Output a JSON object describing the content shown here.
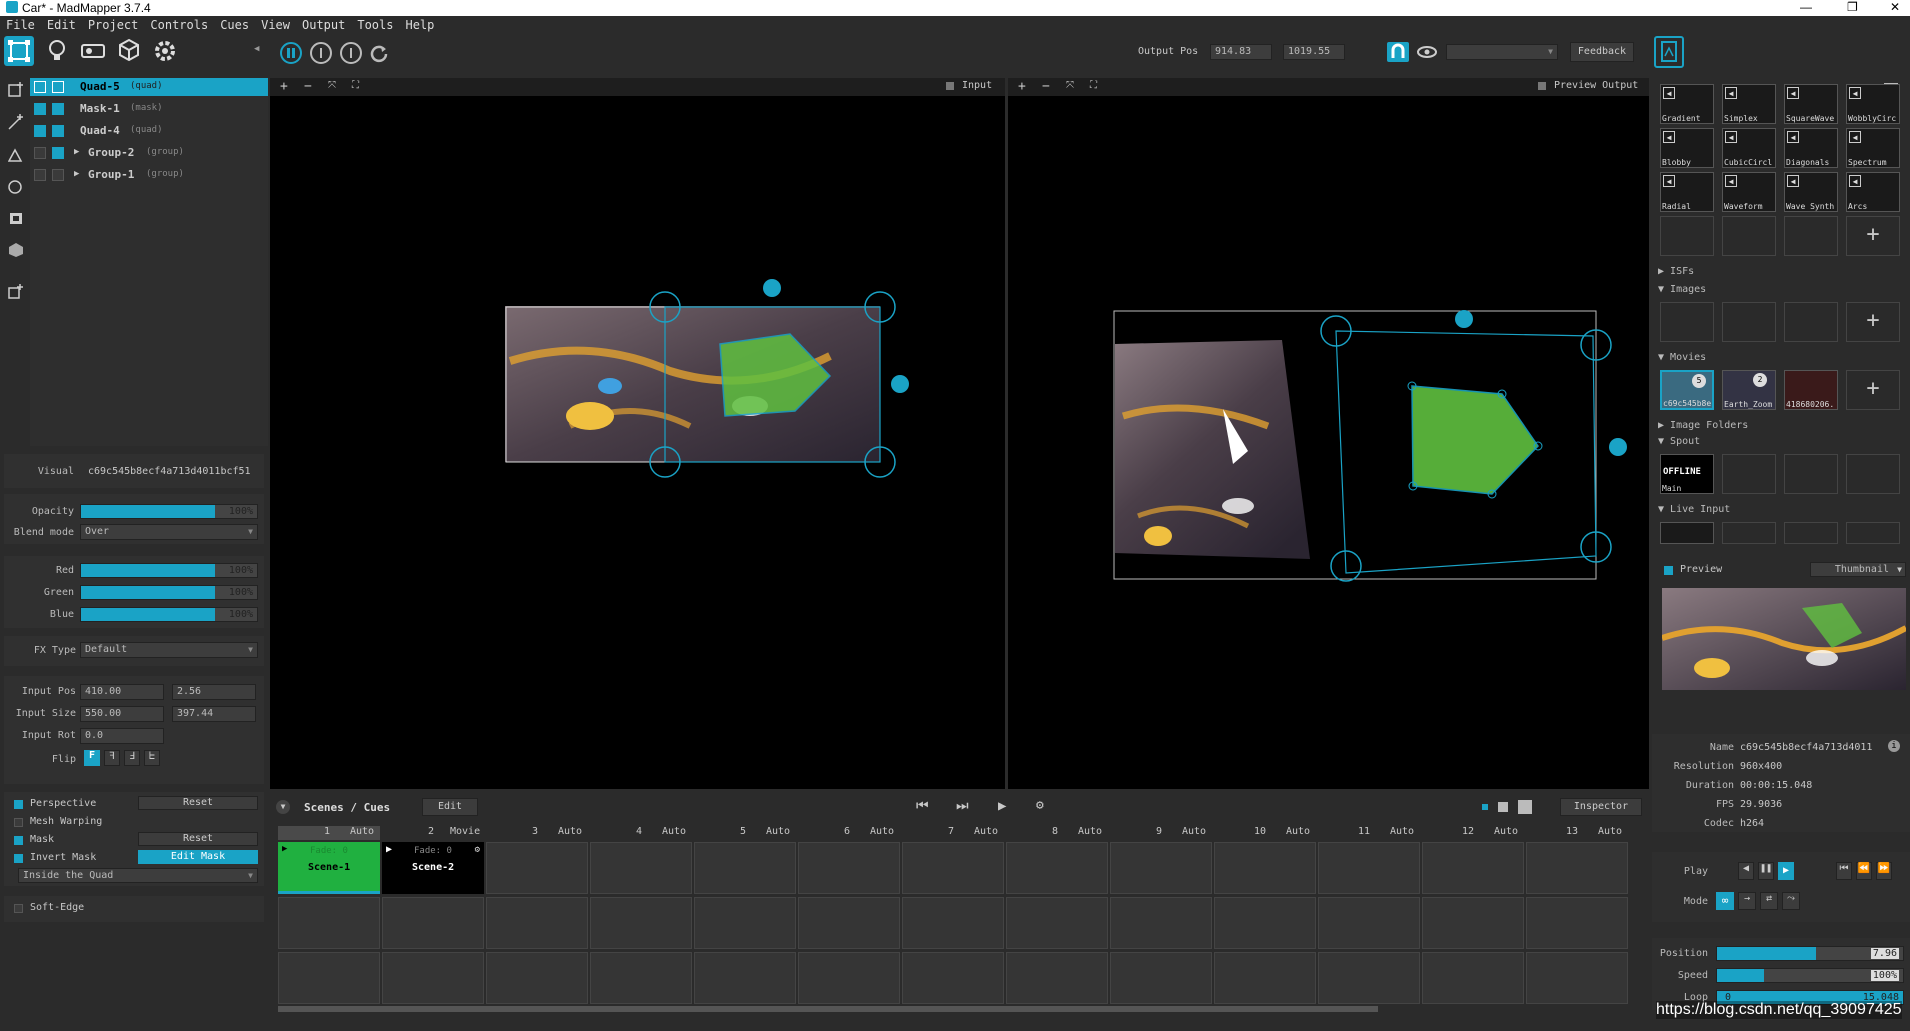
{
  "window": {
    "title": "Car* - MadMapper 3.7.4"
  },
  "menu": [
    "File",
    "Edit",
    "Project",
    "Controls",
    "Cues",
    "View",
    "Output",
    "Tools",
    "Help"
  ],
  "toolbar": {
    "output_pos_label": "Output Pos",
    "output_x": "914.83",
    "output_y": "1019.55",
    "feedback": "Feedback"
  },
  "layers": [
    {
      "name": "Quad-5",
      "type": "(quad)",
      "selected": true
    },
    {
      "name": "Mask-1",
      "type": "(mask)"
    },
    {
      "name": "Quad-4",
      "type": "(quad)"
    },
    {
      "name": "Group-2",
      "type": "(group)"
    },
    {
      "name": "Group-1",
      "type": "(group)"
    }
  ],
  "props": {
    "visual_label": "Visual",
    "visual": "c69c545b8ecf4a713d4011bcf51",
    "opacity_label": "Opacity",
    "opacity": "100%",
    "opacity_value": 1.0,
    "blend_label": "Blend mode",
    "blend": "Over",
    "red_label": "Red",
    "red": "100%",
    "green_label": "Green",
    "green": "100%",
    "blue_label": "Blue",
    "blue": "100%",
    "fx_label": "FX Type",
    "fx": "Default",
    "input_pos_label": "Input Pos",
    "input_pos_x": "410.00",
    "input_pos_y": "2.56",
    "input_size_label": "Input Size",
    "input_size_x": "550.00",
    "input_size_y": "397.44",
    "input_rot_label": "Input Rot",
    "input_rot": "0.0",
    "flip_label": "Flip",
    "perspective": "Perspective",
    "reset1": "Reset",
    "mesh": "Mesh Warping",
    "mask": "Mask",
    "reset2": "Reset",
    "invert": "Invert Mask",
    "edit_mask": "Edit Mask",
    "inside": "Inside the Quad",
    "soft": "Soft-Edge"
  },
  "views": {
    "input": "Input",
    "preview_output": "Preview Output"
  },
  "cues": {
    "title": "Scenes / Cues",
    "edit": "Edit",
    "inspector": "Inspector",
    "columns": [
      {
        "n": "1",
        "mode": "Auto"
      },
      {
        "n": "2",
        "mode": "Movie"
      },
      {
        "n": "3",
        "mode": "Auto"
      },
      {
        "n": "4",
        "mode": "Auto"
      },
      {
        "n": "5",
        "mode": "Auto"
      },
      {
        "n": "6",
        "mode": "Auto"
      },
      {
        "n": "7",
        "mode": "Auto"
      },
      {
        "n": "8",
        "mode": "Auto"
      },
      {
        "n": "9",
        "mode": "Auto"
      },
      {
        "n": "10",
        "mode": "Auto"
      },
      {
        "n": "11",
        "mode": "Auto"
      },
      {
        "n": "12",
        "mode": "Auto"
      },
      {
        "n": "13",
        "mode": "Auto"
      }
    ],
    "scene1": {
      "fade": "Fade: 0",
      "name": "Scene-1"
    },
    "scene2": {
      "fade": "Fade: 0",
      "name": "Scene-2"
    }
  },
  "library": {
    "generators": [
      "Gradient",
      "Simplex",
      "SquareWave",
      "WobblyCirc",
      "Blobby",
      "CubicCircl",
      "Diagonals",
      "Spectrum",
      "Radial",
      "Waveform",
      "Wave Synth",
      "Arcs"
    ],
    "isfs": "ISFs",
    "images": "Images",
    "movies": "Movies",
    "movie_items": [
      {
        "name": "c69c545b8e",
        "badge": "5"
      },
      {
        "name": "Earth_Zoom",
        "badge": "2"
      },
      {
        "name": "418680206."
      }
    ],
    "image_folders": "Image Folders",
    "spout": "Spout",
    "spout_item": "Main",
    "offline": "OFFLINE",
    "live_input": "Live Input"
  },
  "media": {
    "preview": "Preview",
    "thumbnail": "Thumbnail",
    "name_label": "Name",
    "name": "c69c545b8ecf4a713d4011",
    "resolution_label": "Resolution",
    "resolution": "960x400",
    "duration_label": "Duration",
    "duration": "00:00:15.048",
    "fps_label": "FPS",
    "fps": "29.9036",
    "codec_label": "Codec",
    "codec": "h264",
    "play_label": "Play",
    "mode_label": "Mode",
    "position_label": "Position",
    "position": "7.96",
    "position_frac": 0.53,
    "speed_label": "Speed",
    "speed": "100%",
    "speed_frac": 0.25,
    "loop_label": "Loop",
    "loop_start": "0",
    "loop_end": "15.048"
  },
  "watermark": "https://blog.csdn.net/qq_39097425"
}
